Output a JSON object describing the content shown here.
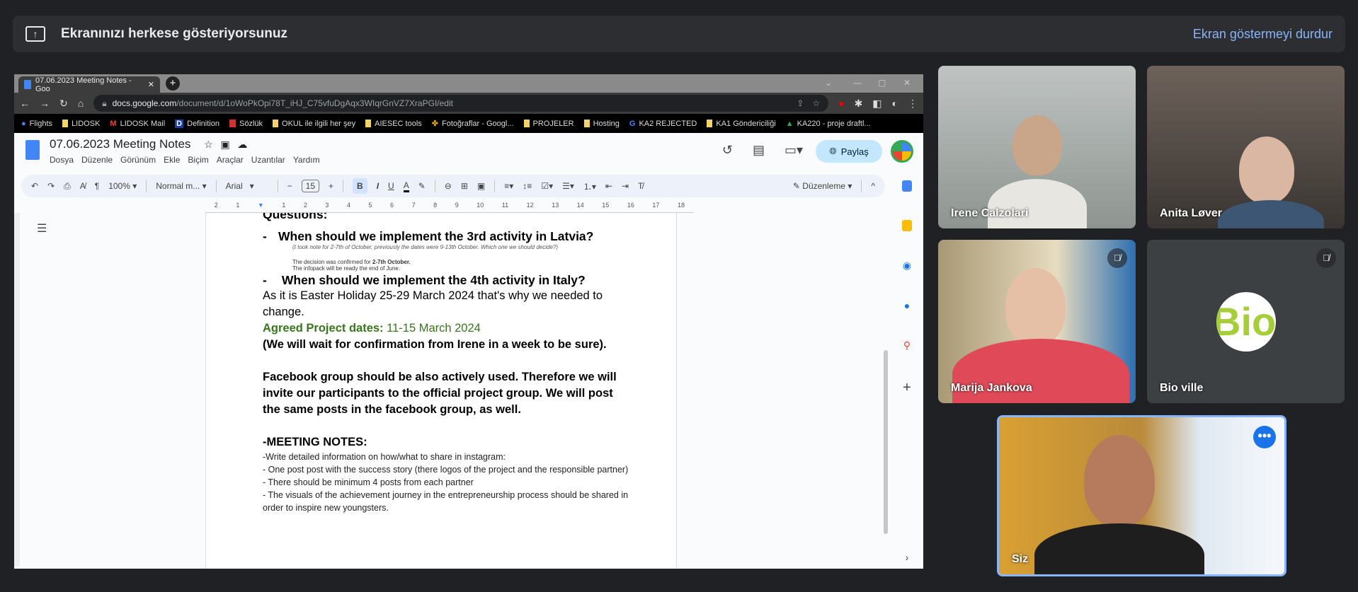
{
  "banner": {
    "text": "Ekranınızı herkese gösteriyorsunuz",
    "stop_label": "Ekran göstermeyi durdur",
    "icon": "present-to-all-icon"
  },
  "browser": {
    "tab_title": "07.06.2023 Meeting Notes - Goo",
    "url_domain": "docs.google.com",
    "url_path": "/document/d/1oWoPkOpi78T_iHJ_C75vfuDgAqx3WIqrGnVZ7XraPGI/edit",
    "bookmarks": [
      "Flights",
      "LIDOSK",
      "LIDOSK Mail",
      "Definition",
      "Sözlük",
      "OKUL ile ilgili her şey",
      "AIESEC tools",
      "Fotoğraflar - Googl...",
      "PROJELER",
      "Hosting",
      "KA2 REJECTED",
      "KA1 Göndericiliği",
      "KA220 - proje draftl..."
    ]
  },
  "docs": {
    "title": "07.06.2023 Meeting Notes",
    "menu": [
      "Dosya",
      "Düzenle",
      "Görünüm",
      "Ekle",
      "Biçim",
      "Araçlar",
      "Uzantılar",
      "Yardım"
    ],
    "share_label": "Paylaş",
    "toolbar": {
      "zoom": "100%",
      "style": "Normal m...",
      "font": "Arial",
      "font_size": "15",
      "mode": "Düzenleme"
    },
    "ruler": [
      "2",
      "1",
      "1",
      "2",
      "3",
      "4",
      "5",
      "6",
      "7",
      "8",
      "9",
      "10",
      "11",
      "12",
      "13",
      "14",
      "15",
      "16",
      "17",
      "18"
    ]
  },
  "content": {
    "heading_cut": "Questions:",
    "q1": "When should we implement the 3rd activity in Latvia?",
    "q1_note": "(I took note for 2-7th of October, previously the dates were 9-13th October. Which one we should decide?)",
    "decision_prefix": "The decision was confirmed for ",
    "decision_bold": "2-7th October.",
    "infopack": "The infopack will be ready the end of June.",
    "q2": "When should we implement the 4th activity in Italy?",
    "easter": "As it is Easter Holiday 25-29 March 2024 that's why we needed to change.",
    "agreed_label": "Agreed Project dates:",
    "agreed_value": " 11-15 March 2024",
    "wait": "(We will wait for confirmation from Irene in a week to be sure).",
    "facebook": "Facebook group should be also actively used. Therefore we will invite our participants to the official project group. We will post the same posts in the facebook group, as well.",
    "meeting_notes": "-MEETING NOTES:",
    "notes": [
      "-Write detailed information on how/what to share in instagram:",
      "- One post post with the success story (there logos of the project and the responsible partner)",
      "- There should be minimum 4 posts from each partner",
      "- The visuals of the achievement journey in the entrepreneurship process should be shared in order to inspire new youngsters."
    ]
  },
  "participants": [
    {
      "name": "Irene Calzolari",
      "muted": false
    },
    {
      "name": "Anita Løver",
      "muted": false
    },
    {
      "name": "Marija Jankova",
      "muted": true
    },
    {
      "name": "Bio ville",
      "muted": true,
      "avatar_text": "Bio"
    },
    {
      "name": "Siz",
      "muted": false,
      "active_speaker": true
    }
  ],
  "colors": {
    "accent": "#8ab4f8",
    "share": "#c2e7ff",
    "speaker_border": "#8ab4f8",
    "agreed_green": "#38761d"
  }
}
